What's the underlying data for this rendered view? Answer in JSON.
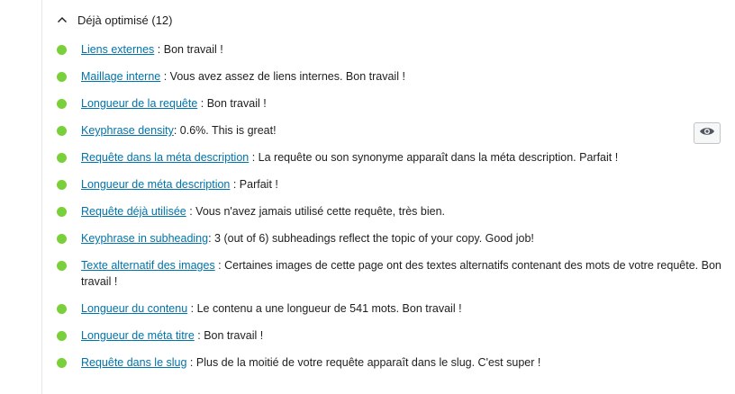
{
  "section": {
    "title": "Déjà optimisé (12)",
    "icon": "chevron-up-icon"
  },
  "colors": {
    "good": "#7ad03a",
    "link": "#0073aa"
  },
  "results": [
    {
      "link": "Liens externes",
      "text": " : Bon travail !"
    },
    {
      "link": "Maillage interne",
      "text": " : Vous avez assez de liens internes. Bon travail !"
    },
    {
      "link": "Longueur de la requête",
      "text": " : Bon travail !"
    },
    {
      "link": "Keyphrase density",
      "text": ": 0.6%. This is great!"
    },
    {
      "link": "Requête dans la méta description",
      "text": " : La requête ou son synonyme apparaît dans la méta description. Parfait !"
    },
    {
      "link": "Longueur de méta description",
      "text": " : Parfait !"
    },
    {
      "link": "Requête déjà utilisée",
      "text": " : Vous n'avez jamais utilisé cette requête, très bien."
    },
    {
      "link": "Keyphrase in subheading",
      "text": ": 3 (out of 6) subheadings reflect the topic of your copy. Good job!"
    },
    {
      "link": "Texte alternatif des images",
      "text": " : Certaines images de cette page ont des textes alternatifs contenant des mots de votre requête. Bon travail !"
    },
    {
      "link": "Longueur du contenu",
      "text": " : Le contenu a une longueur de 541 mots. Bon travail !"
    },
    {
      "link": "Longueur de méta titre",
      "text": " : Bon travail !"
    },
    {
      "link": "Requête dans le slug",
      "text": " : Plus de la moitié de votre requête apparaît dans le slug. C'est super !"
    }
  ],
  "eye_button": {
    "icon": "eye-icon"
  }
}
